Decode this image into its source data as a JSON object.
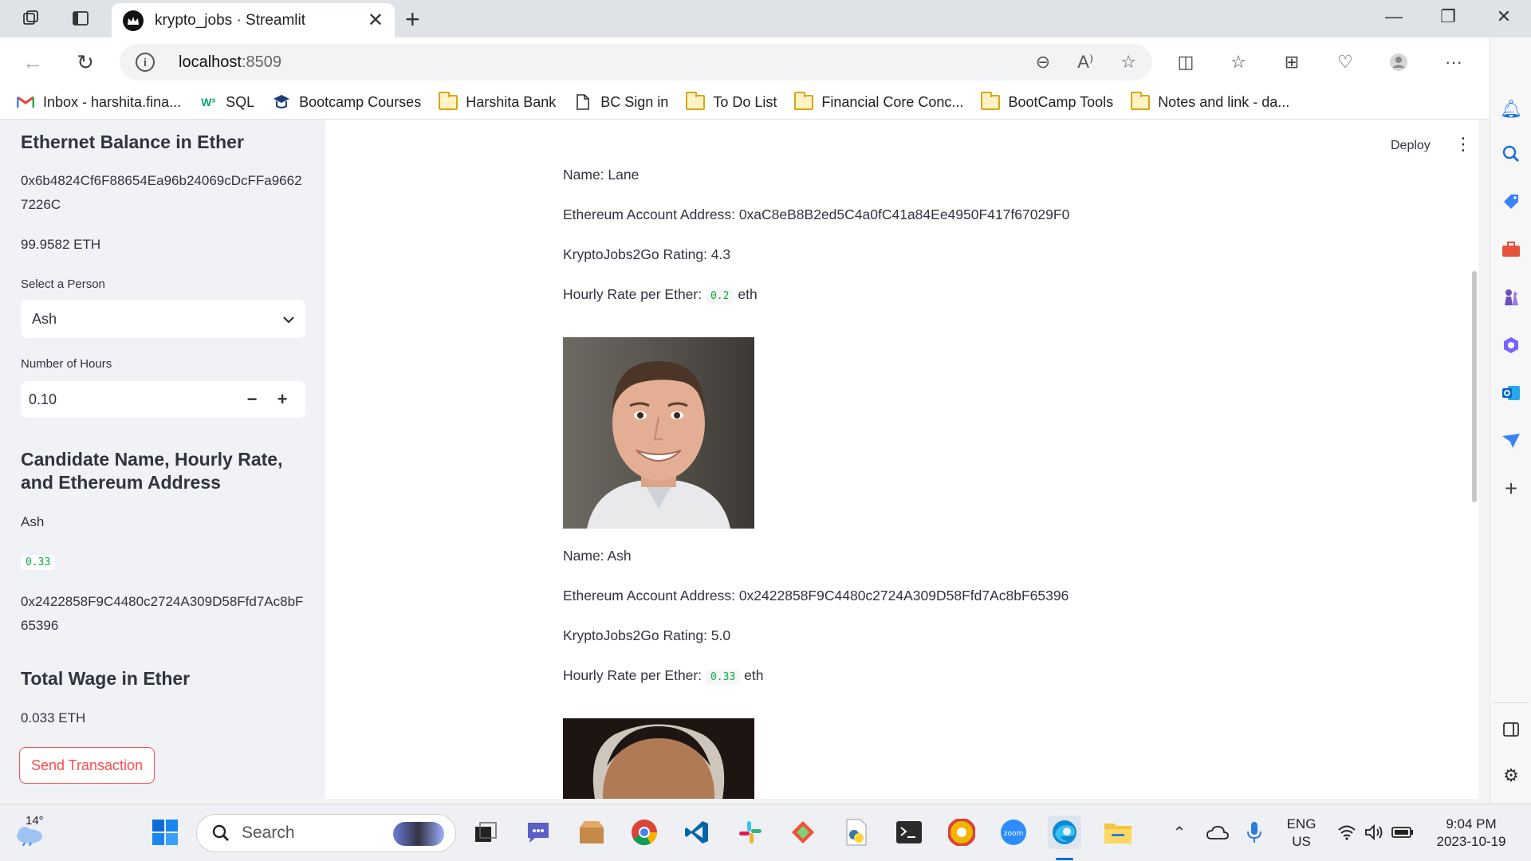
{
  "browser": {
    "tab_title": "krypto_jobs · Streamlit",
    "url_host": "localhost",
    "url_port": ":8509",
    "bookmarks": [
      {
        "label": "Inbox - harshita.fina...",
        "icon": "gmail-icon"
      },
      {
        "label": "SQL",
        "icon": "w3schools-icon"
      },
      {
        "label": "Bootcamp Courses",
        "icon": "bootcamp-icon"
      },
      {
        "label": "Harshita Bank",
        "icon": "folder-icon"
      },
      {
        "label": "BC Sign in",
        "icon": "page-icon"
      },
      {
        "label": "To Do List",
        "icon": "folder-icon"
      },
      {
        "label": "Financial Core Conc...",
        "icon": "folder-icon"
      },
      {
        "label": "BootCamp Tools",
        "icon": "folder-icon"
      },
      {
        "label": "Notes and link - da...",
        "icon": "folder-icon"
      }
    ]
  },
  "sidebar": {
    "balance_heading": "Ethernet Balance in Ether",
    "account_address": "0x6b4824Cf6F88654Ea96b24069cDcFFa9662 7226C",
    "balance": "99.9582 ETH",
    "select_label": "Select a Person",
    "selected_person": "Ash",
    "hours_label": "Number of Hours",
    "hours_value": "0.10",
    "candidate_heading": "Candidate Name, Hourly Rate, and Ethereum Address",
    "candidate_name": "Ash",
    "candidate_rate": "0.33",
    "candidate_address": "0x2422858F9C4480c2724A309D58Ffd7Ac8bF 65396",
    "wage_heading": "Total Wage in Ether",
    "wage_value": "0.033 ETH",
    "send_button": "Send Transaction"
  },
  "main": {
    "deploy_label": "Deploy",
    "candidates": [
      {
        "name_line": "Name: Lane",
        "address_line": "Ethereum Account Address: 0xaC8eB8B2ed5C4a0fC41a84Ee4950F417f67029F0",
        "rating_line": "KryptoJobs2Go Rating: 4.3",
        "rate_label": "Hourly Rate per Ether:",
        "rate_value": "0.2",
        "rate_unit": "eth"
      },
      {
        "name_line": "Name: Ash",
        "address_line": "Ethereum Account Address: 0x2422858F9C4480c2724A309D58Ffd7Ac8bF65396",
        "rating_line": "KryptoJobs2Go Rating: 5.0",
        "rate_label": "Hourly Rate per Ether:",
        "rate_value": "0.33",
        "rate_unit": "eth"
      }
    ]
  },
  "taskbar": {
    "weather_temp": "14°",
    "search_placeholder": "Search",
    "lang_top": "ENG",
    "lang_bottom": "US",
    "time": "9:04 PM",
    "date": "2023-10-19"
  },
  "colors": {
    "streamlit_red": "#ff4b4b",
    "code_green": "#09ab3b",
    "sidebar_bg": "#f0f2f6"
  }
}
